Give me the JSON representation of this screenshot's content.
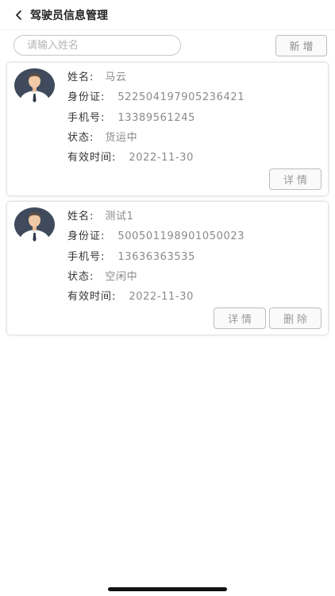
{
  "header": {
    "title": "驾驶员信息管理",
    "back_icon": "chevron-left-icon"
  },
  "search": {
    "placeholder": "请输入姓名",
    "value": "",
    "add_label": "新增"
  },
  "drivers": [
    {
      "name_label": "姓名:",
      "name": "马云",
      "id_label": "身份证:",
      "id_number": "522504197905236421",
      "phone_label": "手机号:",
      "phone": "13389561245",
      "status_label": "状态:",
      "status": "货运中",
      "valid_label": "有效时间:",
      "valid_until": "2022-11-30",
      "detail_label": "详情"
    },
    {
      "name_label": "姓名:",
      "name": "测试1",
      "id_label": "身份证:",
      "id_number": "500501198901050023",
      "phone_label": "手机号:",
      "phone": "13636363535",
      "status_label": "状态:",
      "status": "空闲中",
      "valid_label": "有效时间:",
      "valid_until": "2022-11-30",
      "detail_label": "详情",
      "delete_label": "删除"
    }
  ],
  "colors": {
    "avatar_bg": "#3f4b5c",
    "skin": "#f0c9a6",
    "hair": "#5a4e46",
    "shirt": "#ffffff"
  }
}
